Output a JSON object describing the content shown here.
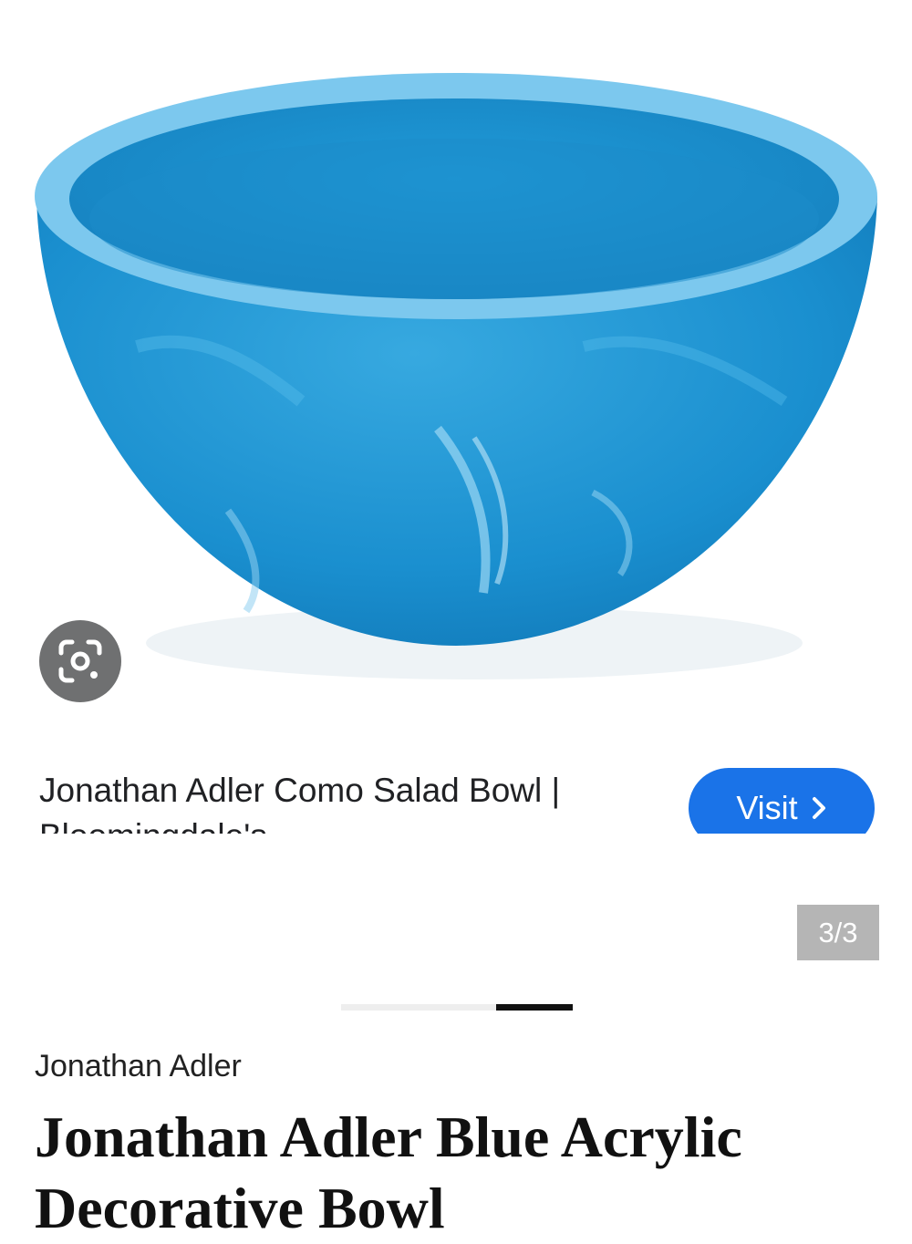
{
  "image": {
    "alt": "blue marbled acrylic bowl",
    "colors": {
      "bowl": "#1e8fcc",
      "bowl_light": "#6ec6f0",
      "rim": "#7fc9ee"
    }
  },
  "lens": {
    "icon": "google-lens-icon"
  },
  "result": {
    "caption": "Jonathan Adler Como Salad Bowl | Bloomingdale's",
    "visit_label": "Visit",
    "visit_icon": "chevron-right-icon",
    "accent": "#1a73e8"
  },
  "carousel": {
    "counter": "3/3",
    "current": 3,
    "total": 3
  },
  "product": {
    "brand": "Jonathan Adler",
    "title": "Jonathan Adler Blue Acrylic Decorative Bowl"
  }
}
